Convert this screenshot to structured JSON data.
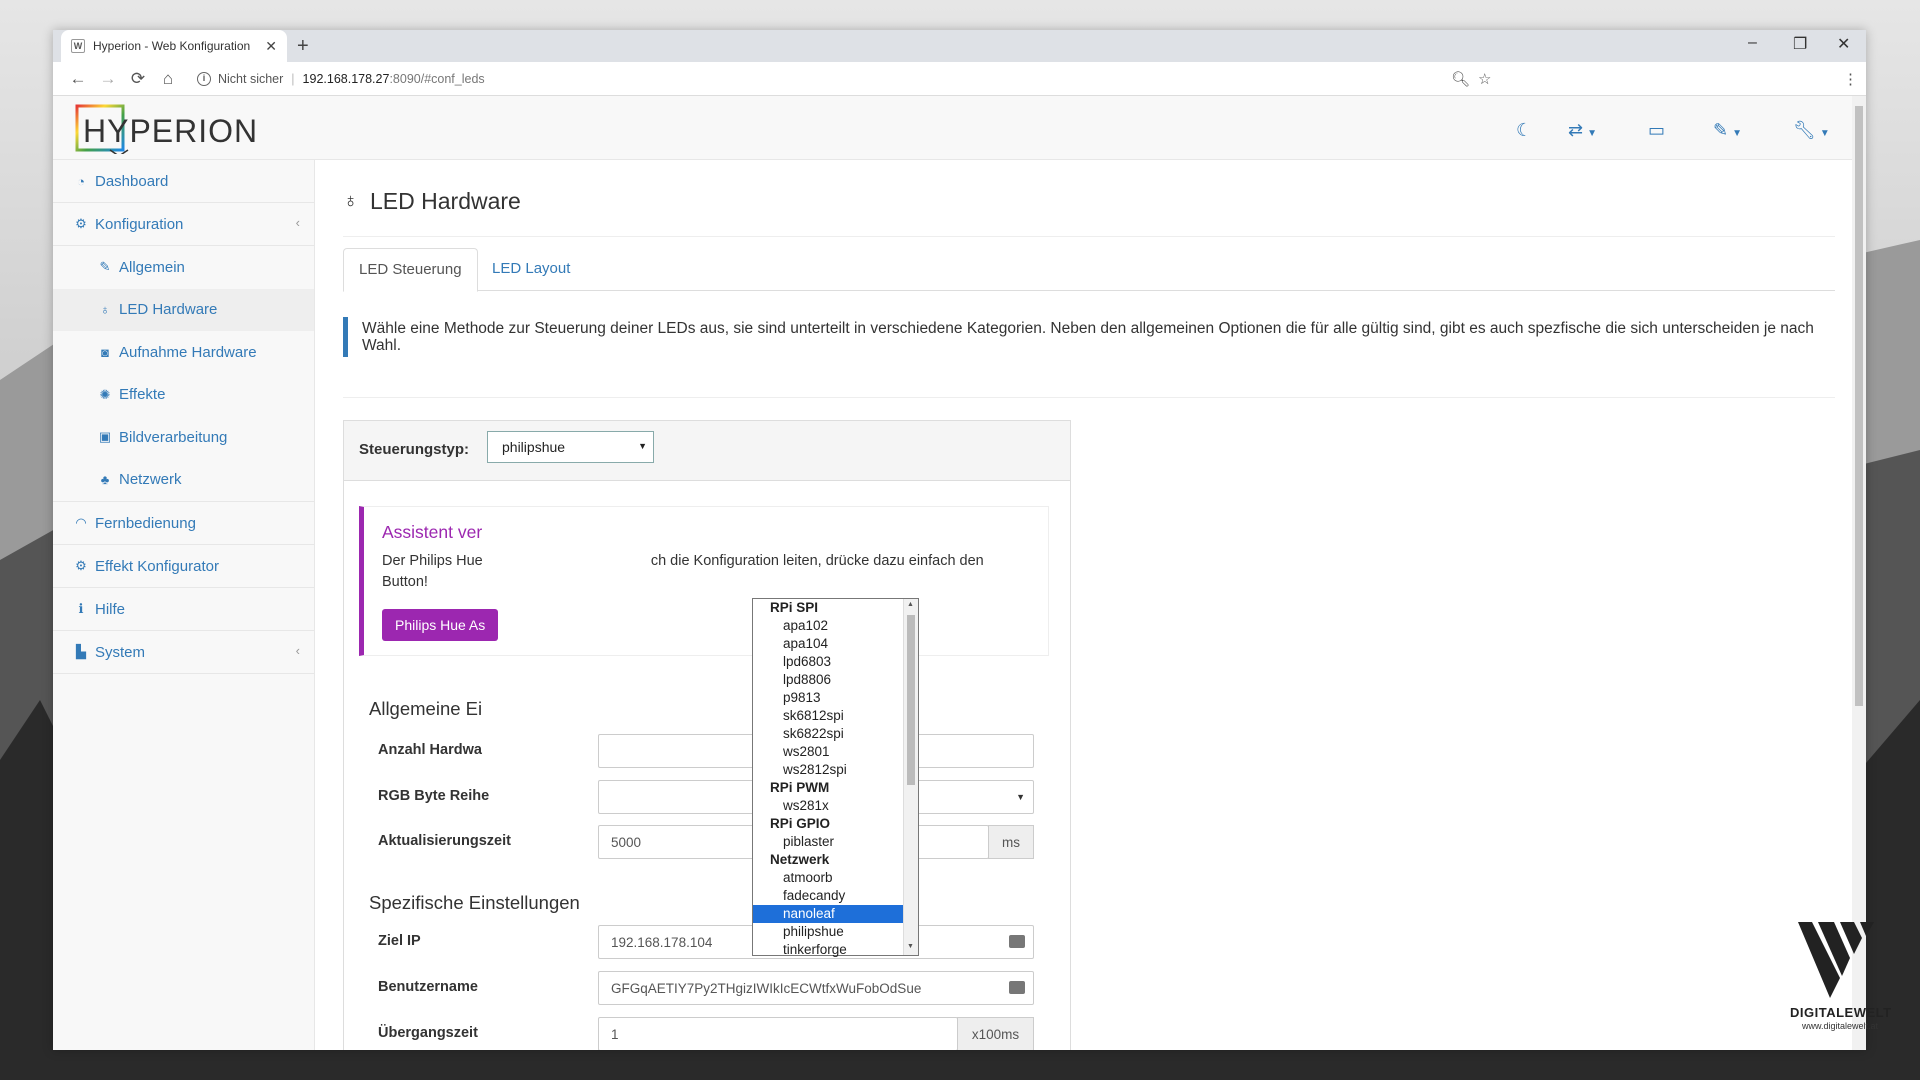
{
  "browser": {
    "tab_title": "Hyperion - Web Konfiguration",
    "tab_favicon": "W",
    "new_tab": "+",
    "url_security": "Nicht sicher",
    "url_host": "192.168.178.27",
    "url_path": ":8090/#conf_leds",
    "win_min": "–",
    "win_max": "❐",
    "win_close": "✕"
  },
  "app": {
    "logo_text": "HYPERION",
    "sidebar": {
      "dashboard": "Dashboard",
      "konfiguration": "Konfiguration",
      "allgemein": "Allgemein",
      "led_hardware": "LED Hardware",
      "aufnahme_hardware": "Aufnahme Hardware",
      "effekte": "Effekte",
      "bildverarbeitung": "Bildverarbeitung",
      "netzwerk": "Netzwerk",
      "fernbedienung": "Fernbedienung",
      "effekt_konfigurator": "Effekt Konfigurator",
      "hilfe": "Hilfe",
      "system": "System"
    },
    "page_title": "LED Hardware",
    "tabs": {
      "steuerung": "LED Steuerung",
      "layout": "LED Layout"
    },
    "intro_text": "Wähle eine Methode zur Steuerung deiner LEDs aus, sie sind unterteilt in verschiedene Kategorien. Neben den allgemeinen Optionen die für alle gültig sind, gibt es auch spezfische die sich unterscheiden je nach Wahl.",
    "controller": {
      "label": "Steuerungstyp:",
      "value": "philipshue"
    },
    "dropdown": {
      "groups": [
        {
          "label": "RPi SPI",
          "items": [
            "apa102",
            "apa104",
            "lpd6803",
            "lpd8806",
            "p9813",
            "sk6812spi",
            "sk6822spi",
            "ws2801",
            "ws2812spi"
          ]
        },
        {
          "label": "RPi PWM",
          "items": [
            "ws281x"
          ]
        },
        {
          "label": "RPi GPIO",
          "items": [
            "piblaster"
          ]
        },
        {
          "label": "Netzwerk",
          "items": [
            "atmoorb",
            "fadecandy",
            "nanoleaf",
            "philipshue",
            "tinkerforge"
          ]
        }
      ],
      "highlighted": "nanoleaf"
    },
    "callout": {
      "title": "Assistent ver",
      "text_left": "Der Philips Hue",
      "text_right": "ch die Konfiguration leiten, drücke dazu einfach den",
      "text_line2": "Button!",
      "button": "Philips Hue As"
    },
    "general": {
      "title": "Allgemeine Ei",
      "count_label": "Anzahl Hardwa",
      "order_label": "RGB Byte Reihe",
      "refresh_label": "Aktualisierungszeit",
      "refresh_value": "5000",
      "refresh_unit": "ms"
    },
    "specific": {
      "title": "Spezifische Einstellungen",
      "ip_label": "Ziel IP",
      "ip_value": "192.168.178.104",
      "user_label": "Benutzername",
      "user_value": "GFGqAETIY7Py2THgizIWIkIcECWtfxWuFobOdSue",
      "transition_label": "Übergangszeit",
      "transition_value": "1",
      "transition_unit": "x100ms"
    }
  },
  "watermark": {
    "name": "DIGITALEWELT",
    "url": "www.digitalewelt.at"
  }
}
